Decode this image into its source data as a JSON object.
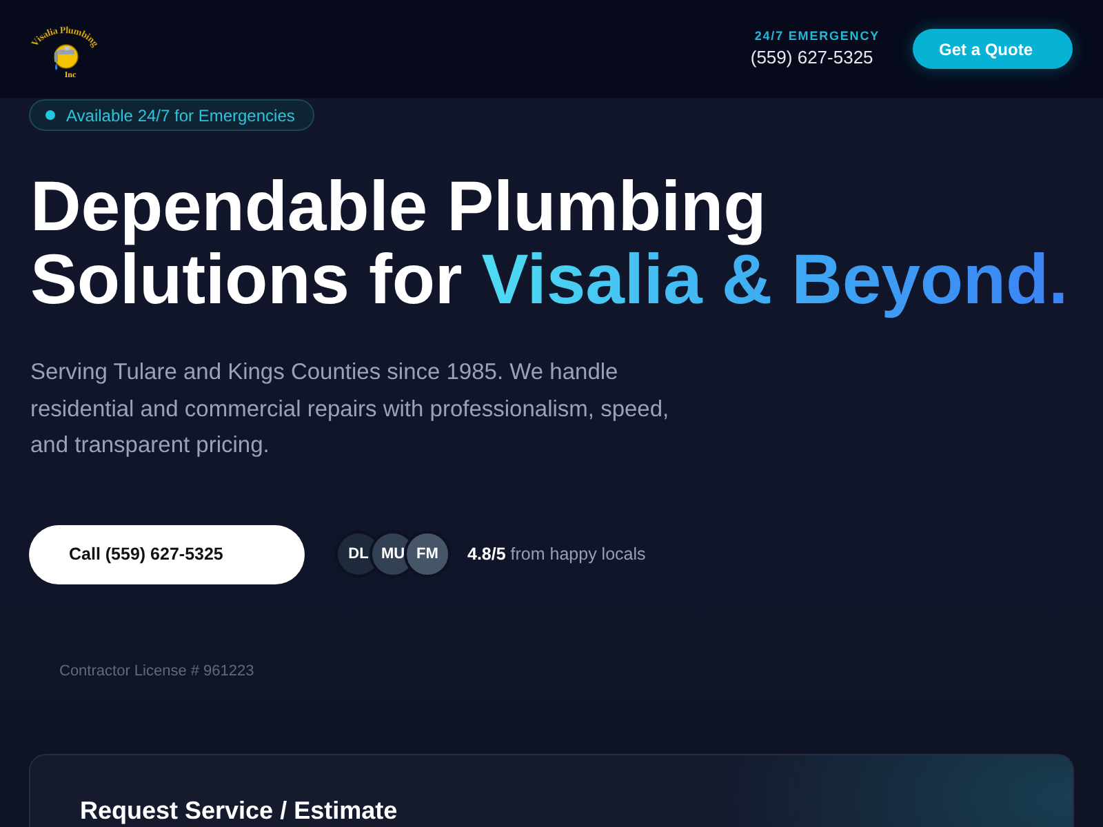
{
  "header": {
    "logo": {
      "arc_text": "Visalia Plumbing",
      "sub_text": "Inc"
    },
    "emergency_label": "24/7 EMERGENCY",
    "phone": "(559) 627-5325",
    "quote_button": "Get a Quote"
  },
  "hero": {
    "badge": "Available 24/7 for Emergencies",
    "headline": {
      "text": "Dependable Plumbing Solutions for",
      "highlight": "Visalia & Beyond."
    },
    "description": "Serving Tulare and Kings Counties since 1985. We handle residential and commercial repairs with professionalism, speed, and transparent pricing.",
    "call_button": "Call (559) 627-5325",
    "avatars": [
      {
        "initials": "DL",
        "color": "#1e293b"
      },
      {
        "initials": "MU",
        "color": "#334155"
      },
      {
        "initials": "FM",
        "color": "#475569"
      }
    ],
    "rating": "**4.8/5** from happy locals",
    "license": "Contractor License # 961223"
  },
  "request_card": {
    "title": "Request Service / Estimate"
  }
}
